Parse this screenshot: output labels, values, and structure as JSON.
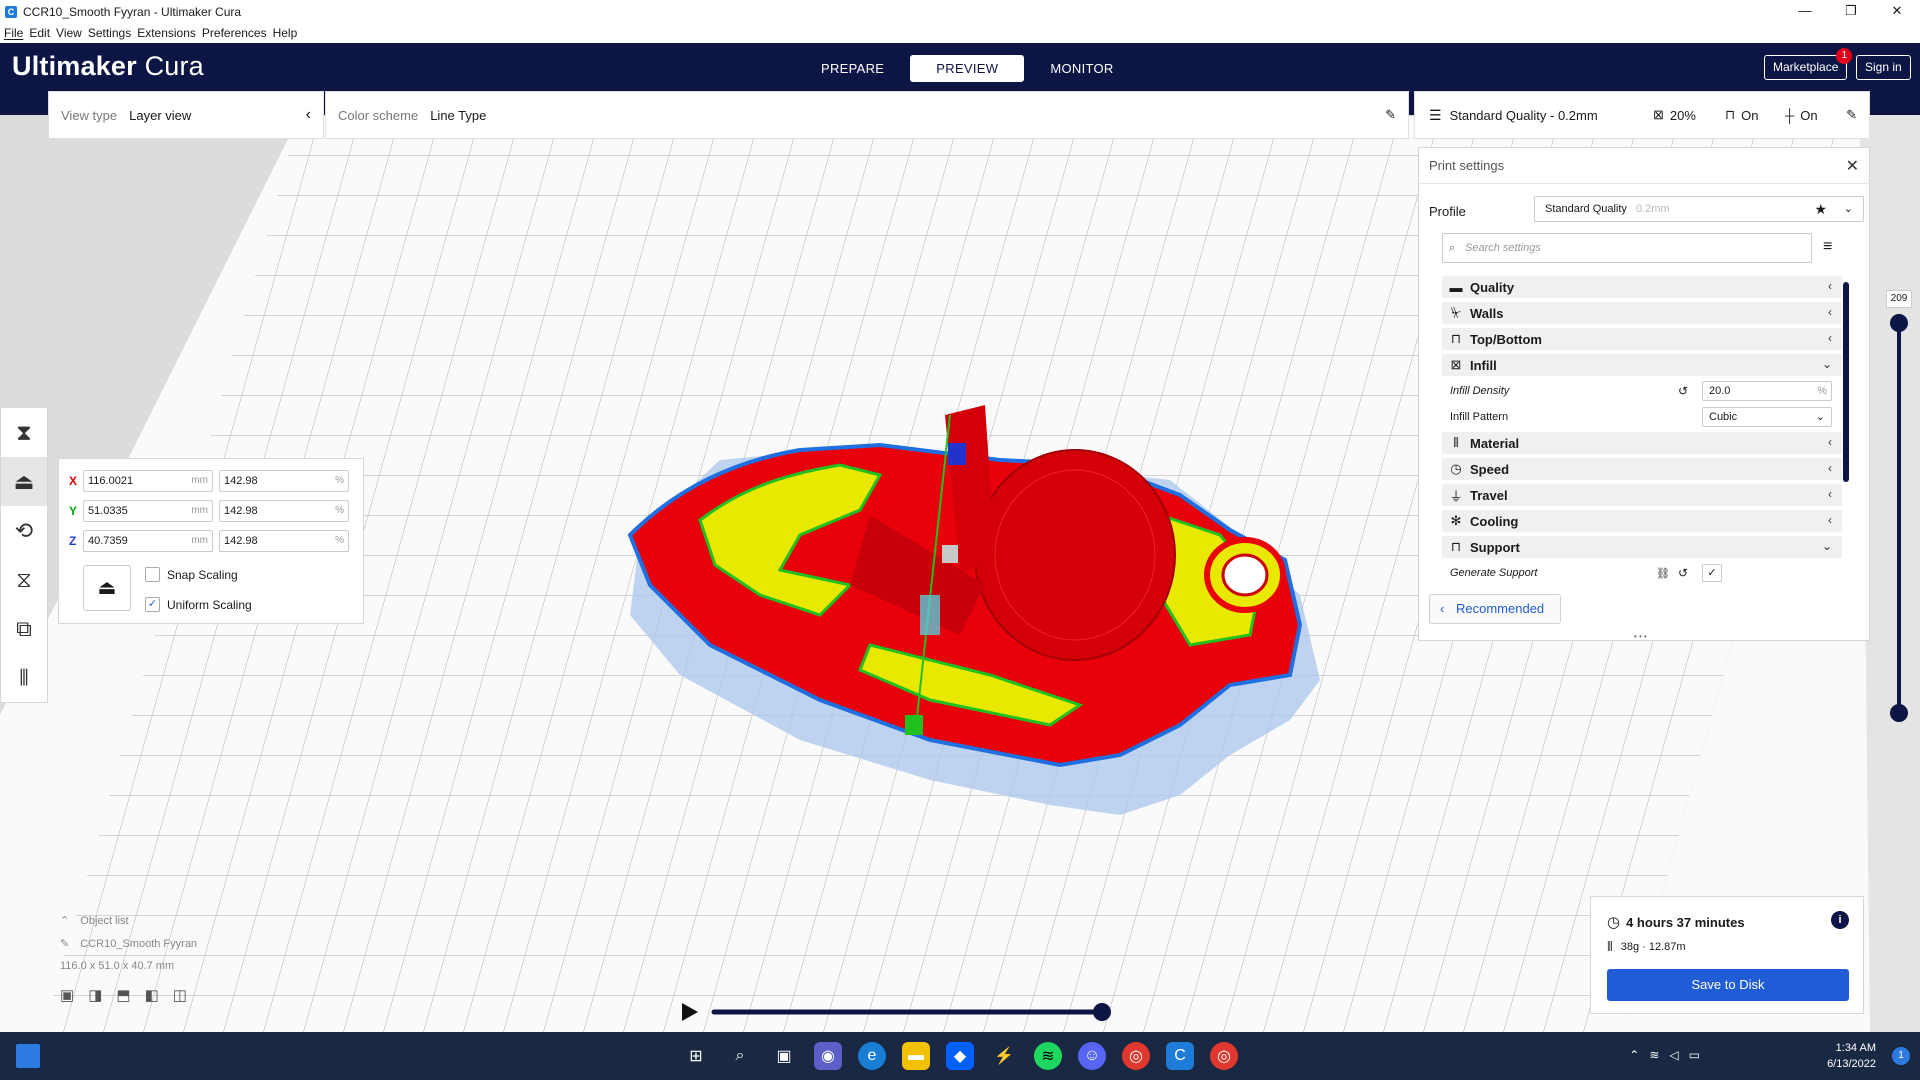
{
  "window": {
    "title": "CCR10_Smooth Fyyran - Ultimaker Cura",
    "minimize": "—",
    "maximize": "❐",
    "close": "✕"
  },
  "menu": [
    "File",
    "Edit",
    "View",
    "Settings",
    "Extensions",
    "Preferences",
    "Help"
  ],
  "header": {
    "logo_bold": "Ultimaker",
    "logo_light": "Cura",
    "stages": [
      "PREPARE",
      "PREVIEW",
      "MONITOR"
    ],
    "active_stage": "PREVIEW",
    "marketplace": "Marketplace",
    "marketplace_badge": "1",
    "sign_in": "Sign in"
  },
  "view_type": {
    "label": "View type",
    "value": "Layer view"
  },
  "color_scheme": {
    "label": "Color scheme",
    "value": "Line Type"
  },
  "quality_bar": {
    "profile": "Standard Quality - 0.2mm",
    "infill": "20%",
    "support": "On",
    "adhesion": "On"
  },
  "print_settings": {
    "title": "Print settings",
    "profile_label": "Profile",
    "profile_value": "Standard Quality",
    "profile_sub": "0.2mm",
    "search_placeholder": "Search settings",
    "categories": [
      {
        "label": "Quality",
        "icon": "quality-icon",
        "expanded": false
      },
      {
        "label": "Walls",
        "icon": "walls-icon",
        "expanded": false
      },
      {
        "label": "Top/Bottom",
        "icon": "top-bottom-icon",
        "expanded": false
      },
      {
        "label": "Infill",
        "icon": "infill-icon",
        "expanded": true
      }
    ],
    "infill_density_label": "Infill Density",
    "infill_density_value": "20.0",
    "infill_density_unit": "%",
    "infill_pattern_label": "Infill Pattern",
    "infill_pattern_value": "Cubic",
    "categories2": [
      "Material",
      "Speed",
      "Travel",
      "Cooling",
      "Support"
    ],
    "generate_support_label": "Generate Support",
    "recommended": "Recommended",
    "more": "• • •"
  },
  "scale": {
    "x_mm": "116.0021",
    "x_pct": "142.98",
    "y_mm": "51.0335",
    "y_pct": "142.98",
    "z_mm": "40.7359",
    "z_pct": "142.98",
    "unit_mm": "mm",
    "unit_pct": "%",
    "snap": "Snap Scaling",
    "uniform": "Uniform Scaling",
    "x_axis": "X",
    "y_axis": "Y",
    "z_axis": "Z"
  },
  "layer_slider": {
    "value": "209"
  },
  "object_list": {
    "label": "Object list",
    "name": "CCR10_Smooth Fyyran",
    "dims": "116.0 x 51.0 x 40.7 mm"
  },
  "estimate": {
    "time": "4 hours 37 minutes",
    "material": "38g · 12.87m",
    "save": "Save to Disk"
  },
  "clock": {
    "time": "1:34 AM",
    "date": "6/13/2022",
    "notify": "1"
  },
  "colors": {
    "header": "#0c1543",
    "accent": "#1f5cd6",
    "model_red": "#e8000b",
    "infill_yellow": "#e8e800",
    "support_cyan": "#5cc8d8",
    "taskbar": "#1a2943"
  }
}
